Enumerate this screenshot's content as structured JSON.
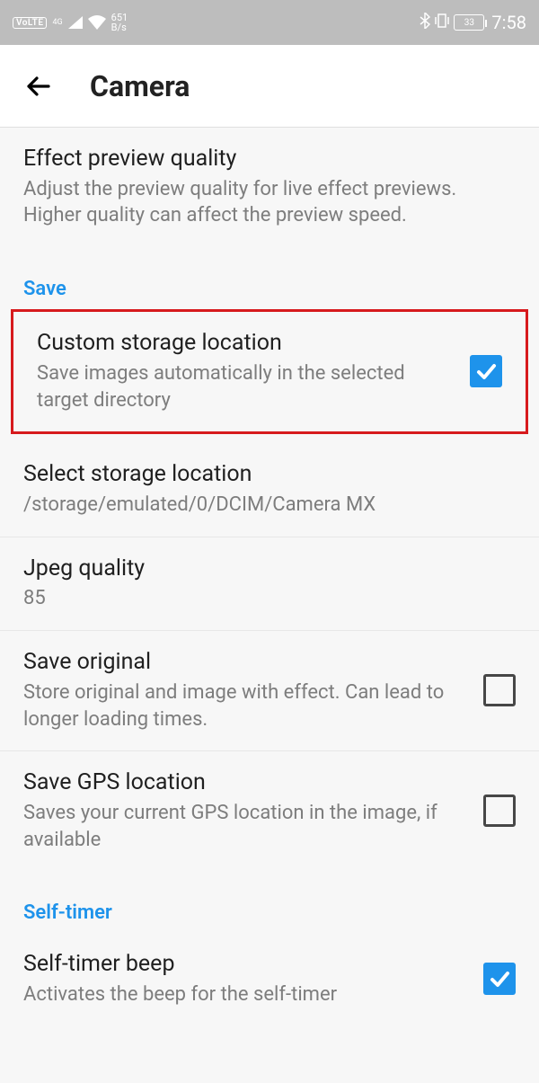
{
  "statusbar": {
    "volte": "VoLTE",
    "netgen": "4G",
    "speed_value": "651",
    "speed_unit": "B/s",
    "battery": "33",
    "time": "7:58"
  },
  "header": {
    "title": "Camera"
  },
  "settings": {
    "effect_preview": {
      "title": "Effect preview quality",
      "sub": "Adjust the preview quality for live effect previews. Higher quality can affect the preview speed."
    },
    "section_save": "Save",
    "custom_storage": {
      "title": "Custom storage location",
      "sub": "Save images automatically in the selected target directory"
    },
    "select_storage": {
      "title": "Select storage location",
      "sub": "/storage/emulated/0/DCIM/Camera MX"
    },
    "jpeg_quality": {
      "title": "Jpeg quality",
      "sub": "85"
    },
    "save_original": {
      "title": "Save original",
      "sub": "Store original and image with effect. Can lead to longer loading times."
    },
    "save_gps": {
      "title": "Save GPS location",
      "sub": "Saves your current GPS location in the image, if available"
    },
    "section_selftimer": "Self-timer",
    "selftimer_beep": {
      "title": "Self-timer beep",
      "sub": "Activates the beep for the self-timer"
    }
  }
}
